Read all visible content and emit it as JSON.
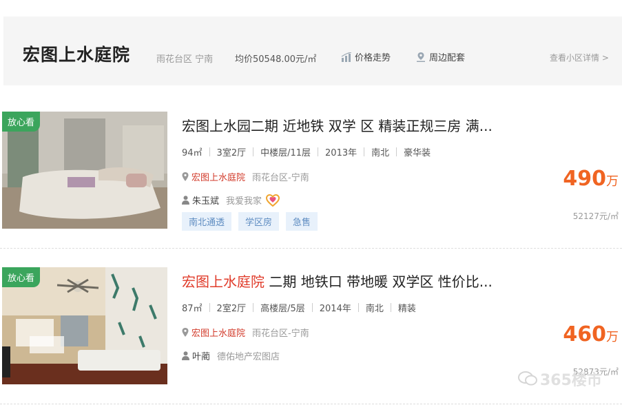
{
  "header": {
    "title": "宏图上水庭院",
    "area": "雨花台区 宁南",
    "avg_price": "均价50548.00元/㎡",
    "price_trend": "价格走势",
    "nearby": "周边配套",
    "detail_link": "查看小区详情 >"
  },
  "listings": [
    {
      "badge": "放心看",
      "title_prefix": "",
      "title": "宏图上水园二期 近地铁 双学 区 精装正规三房 满...",
      "attrs": [
        "94㎡",
        "3室2厅",
        "中楼层/11层",
        "2013年",
        "南北",
        "豪华装"
      ],
      "community": "宏图上水庭院",
      "district": "雨花台区-宁南",
      "agent": "朱玉斌",
      "shop": "我爱我家",
      "tags": [
        "南北通透",
        "学区房",
        "急售"
      ],
      "price": "490",
      "price_unit": "万",
      "unit_price": "52127元/㎡"
    },
    {
      "badge": "放心看",
      "title_prefix": "宏图上水庭院",
      "title": " 二期 地铁口 带地暖 双学区 性价比...",
      "attrs": [
        "87㎡",
        "2室2厅",
        "高楼层/5层",
        "2014年",
        "南北",
        "精装"
      ],
      "community": "宏图上水庭院",
      "district": "雨花台区-宁南",
      "agent": "叶蔺",
      "shop": "德佑地产宏图店",
      "tags": [],
      "price": "460",
      "price_unit": "万",
      "unit_price": "52873元/㎡"
    }
  ],
  "watermark": "365楼市"
}
